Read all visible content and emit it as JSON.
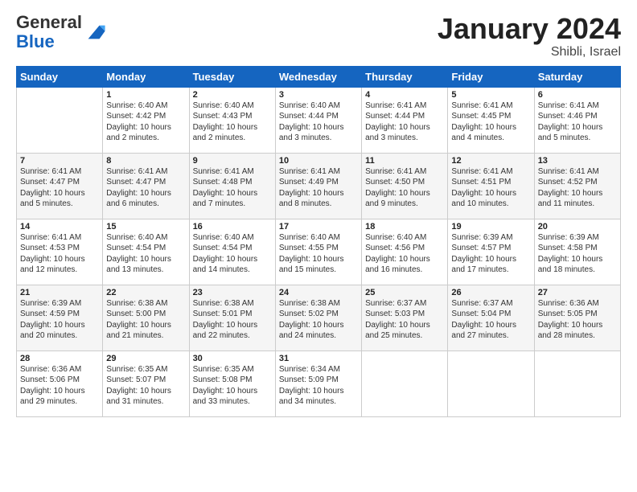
{
  "header": {
    "logo_general": "General",
    "logo_blue": "Blue",
    "month_title": "January 2024",
    "location": "Shibli, Israel"
  },
  "days_of_week": [
    "Sunday",
    "Monday",
    "Tuesday",
    "Wednesday",
    "Thursday",
    "Friday",
    "Saturday"
  ],
  "weeks": [
    [
      {
        "num": "",
        "info": ""
      },
      {
        "num": "1",
        "info": "Sunrise: 6:40 AM\nSunset: 4:42 PM\nDaylight: 10 hours\nand 2 minutes."
      },
      {
        "num": "2",
        "info": "Sunrise: 6:40 AM\nSunset: 4:43 PM\nDaylight: 10 hours\nand 2 minutes."
      },
      {
        "num": "3",
        "info": "Sunrise: 6:40 AM\nSunset: 4:44 PM\nDaylight: 10 hours\nand 3 minutes."
      },
      {
        "num": "4",
        "info": "Sunrise: 6:41 AM\nSunset: 4:44 PM\nDaylight: 10 hours\nand 3 minutes."
      },
      {
        "num": "5",
        "info": "Sunrise: 6:41 AM\nSunset: 4:45 PM\nDaylight: 10 hours\nand 4 minutes."
      },
      {
        "num": "6",
        "info": "Sunrise: 6:41 AM\nSunset: 4:46 PM\nDaylight: 10 hours\nand 5 minutes."
      }
    ],
    [
      {
        "num": "7",
        "info": "Sunrise: 6:41 AM\nSunset: 4:47 PM\nDaylight: 10 hours\nand 5 minutes."
      },
      {
        "num": "8",
        "info": "Sunrise: 6:41 AM\nSunset: 4:47 PM\nDaylight: 10 hours\nand 6 minutes."
      },
      {
        "num": "9",
        "info": "Sunrise: 6:41 AM\nSunset: 4:48 PM\nDaylight: 10 hours\nand 7 minutes."
      },
      {
        "num": "10",
        "info": "Sunrise: 6:41 AM\nSunset: 4:49 PM\nDaylight: 10 hours\nand 8 minutes."
      },
      {
        "num": "11",
        "info": "Sunrise: 6:41 AM\nSunset: 4:50 PM\nDaylight: 10 hours\nand 9 minutes."
      },
      {
        "num": "12",
        "info": "Sunrise: 6:41 AM\nSunset: 4:51 PM\nDaylight: 10 hours\nand 10 minutes."
      },
      {
        "num": "13",
        "info": "Sunrise: 6:41 AM\nSunset: 4:52 PM\nDaylight: 10 hours\nand 11 minutes."
      }
    ],
    [
      {
        "num": "14",
        "info": "Sunrise: 6:41 AM\nSunset: 4:53 PM\nDaylight: 10 hours\nand 12 minutes."
      },
      {
        "num": "15",
        "info": "Sunrise: 6:40 AM\nSunset: 4:54 PM\nDaylight: 10 hours\nand 13 minutes."
      },
      {
        "num": "16",
        "info": "Sunrise: 6:40 AM\nSunset: 4:54 PM\nDaylight: 10 hours\nand 14 minutes."
      },
      {
        "num": "17",
        "info": "Sunrise: 6:40 AM\nSunset: 4:55 PM\nDaylight: 10 hours\nand 15 minutes."
      },
      {
        "num": "18",
        "info": "Sunrise: 6:40 AM\nSunset: 4:56 PM\nDaylight: 10 hours\nand 16 minutes."
      },
      {
        "num": "19",
        "info": "Sunrise: 6:39 AM\nSunset: 4:57 PM\nDaylight: 10 hours\nand 17 minutes."
      },
      {
        "num": "20",
        "info": "Sunrise: 6:39 AM\nSunset: 4:58 PM\nDaylight: 10 hours\nand 18 minutes."
      }
    ],
    [
      {
        "num": "21",
        "info": "Sunrise: 6:39 AM\nSunset: 4:59 PM\nDaylight: 10 hours\nand 20 minutes."
      },
      {
        "num": "22",
        "info": "Sunrise: 6:38 AM\nSunset: 5:00 PM\nDaylight: 10 hours\nand 21 minutes."
      },
      {
        "num": "23",
        "info": "Sunrise: 6:38 AM\nSunset: 5:01 PM\nDaylight: 10 hours\nand 22 minutes."
      },
      {
        "num": "24",
        "info": "Sunrise: 6:38 AM\nSunset: 5:02 PM\nDaylight: 10 hours\nand 24 minutes."
      },
      {
        "num": "25",
        "info": "Sunrise: 6:37 AM\nSunset: 5:03 PM\nDaylight: 10 hours\nand 25 minutes."
      },
      {
        "num": "26",
        "info": "Sunrise: 6:37 AM\nSunset: 5:04 PM\nDaylight: 10 hours\nand 27 minutes."
      },
      {
        "num": "27",
        "info": "Sunrise: 6:36 AM\nSunset: 5:05 PM\nDaylight: 10 hours\nand 28 minutes."
      }
    ],
    [
      {
        "num": "28",
        "info": "Sunrise: 6:36 AM\nSunset: 5:06 PM\nDaylight: 10 hours\nand 29 minutes."
      },
      {
        "num": "29",
        "info": "Sunrise: 6:35 AM\nSunset: 5:07 PM\nDaylight: 10 hours\nand 31 minutes."
      },
      {
        "num": "30",
        "info": "Sunrise: 6:35 AM\nSunset: 5:08 PM\nDaylight: 10 hours\nand 33 minutes."
      },
      {
        "num": "31",
        "info": "Sunrise: 6:34 AM\nSunset: 5:09 PM\nDaylight: 10 hours\nand 34 minutes."
      },
      {
        "num": "",
        "info": ""
      },
      {
        "num": "",
        "info": ""
      },
      {
        "num": "",
        "info": ""
      }
    ]
  ]
}
